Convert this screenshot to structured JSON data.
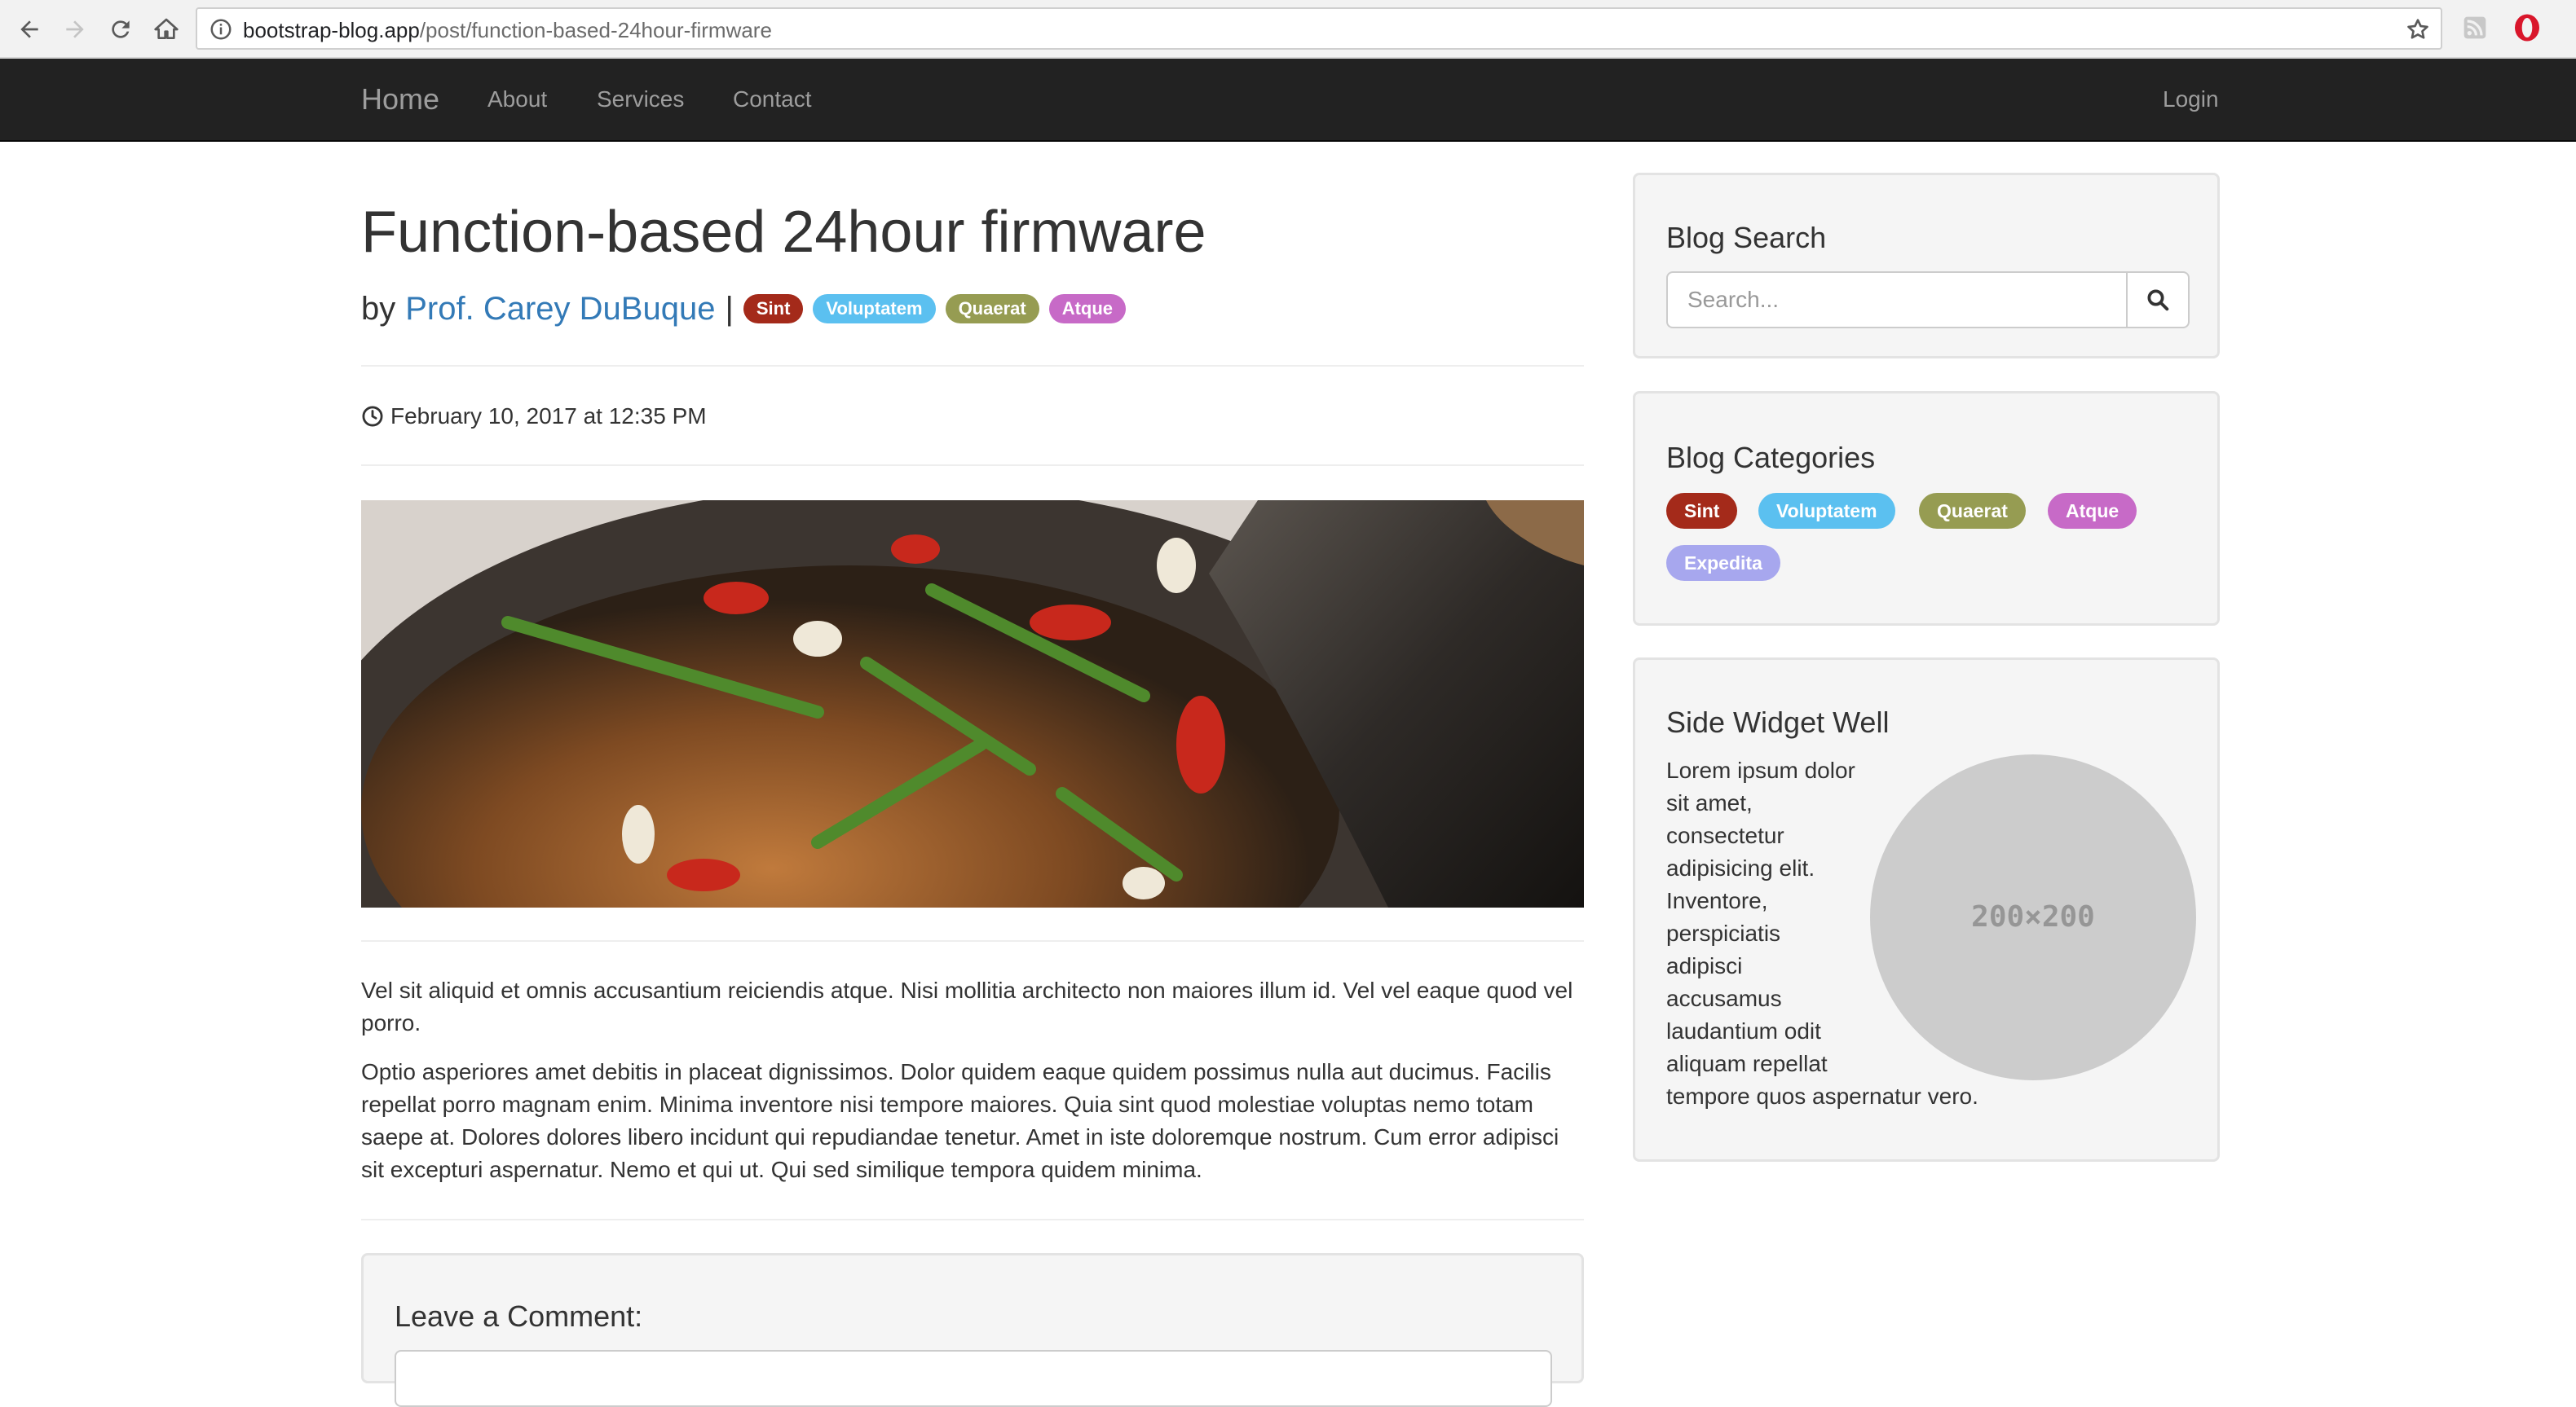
{
  "browser": {
    "url_host": "bootstrap-blog.app",
    "url_path": "/post/function-based-24hour-firmware"
  },
  "navbar": {
    "brand": "Home",
    "links": [
      "About",
      "Services",
      "Contact"
    ],
    "login": "Login"
  },
  "post": {
    "title": "Function-based 24hour firmware",
    "by_prefix": "by",
    "author": "Prof. Carey DuBuque",
    "separator": "|",
    "tags": [
      "Sint",
      "Voluptatem",
      "Quaerat",
      "Atque"
    ],
    "date": "February 10, 2017 at 12:35 PM",
    "paragraphs": [
      "Vel sit aliquid et omnis accusantium reiciendis atque. Nisi mollitia architecto non maiores illum id. Vel vel eaque quod vel porro.",
      "Optio asperiores amet debitis in placeat dignissimos. Dolor quidem eaque quidem possimus nulla aut ducimus. Facilis repellat porro magnam enim. Minima inventore nisi tempore maiores. Quia sint quod molestiae voluptas nemo totam saepe at. Dolores dolores libero incidunt qui repudiandae tenetur. Amet in iste doloremque nostrum. Cum error adipisci sit excepturi aspernatur. Nemo et qui ut. Qui sed similique tempora quidem minima."
    ]
  },
  "comment": {
    "heading": "Leave a Comment:"
  },
  "sidebar": {
    "search": {
      "heading": "Blog Search",
      "placeholder": "Search..."
    },
    "categories": {
      "heading": "Blog Categories",
      "items": [
        "Sint",
        "Voluptatem",
        "Quaerat",
        "Atque",
        "Expedita"
      ]
    },
    "widget": {
      "heading": "Side Widget Well",
      "placeholder_label": "200×200",
      "text": "Lorem ipsum dolor sit amet, consectetur adipisicing elit. Inventore, perspiciatis adipisci accusamus laudantium odit aliquam repellat tempore quos aspernatur vero."
    }
  },
  "colors": {
    "navbar_bg": "#222222",
    "link": "#337ab7",
    "tag_sint": "#a42a1a",
    "tag_voluptatem": "#5bc0f0",
    "tag_quaerat": "#969c52",
    "tag_atque": "#c76ac7",
    "tag_expedita": "#a7a7ee"
  }
}
